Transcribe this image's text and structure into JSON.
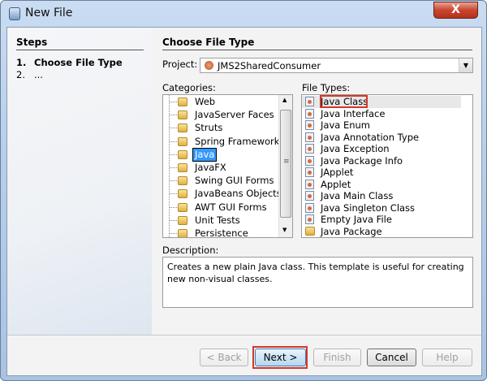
{
  "window": {
    "title": "New File",
    "close": "X"
  },
  "steps": {
    "heading": "Steps",
    "items": [
      {
        "num": "1.",
        "label": "Choose File Type"
      },
      {
        "num": "2.",
        "label": "..."
      }
    ]
  },
  "main": {
    "heading": "Choose File Type",
    "project_label": "Project:",
    "project_value": "JMS2SharedConsumer",
    "categories_label": "Categories:",
    "categories": [
      "Web",
      "JavaServer Faces",
      "Struts",
      "Spring Framework",
      "Java",
      "JavaFX",
      "Swing GUI Forms",
      "JavaBeans Objects",
      "AWT GUI Forms",
      "Unit Tests",
      "Persistence"
    ],
    "selected_category": "Java",
    "file_types_label": "File Types:",
    "file_types": [
      "Java Class",
      "Java Interface",
      "Java Enum",
      "Java Annotation Type",
      "Java Exception",
      "Java Package Info",
      "JApplet",
      "Applet",
      "Java Main Class",
      "Java Singleton Class",
      "Empty Java File",
      "Java Package"
    ],
    "selected_file_type": "Java Class",
    "description_label": "Description:",
    "description": "Creates a new plain Java class. This template is useful for creating new non-visual classes."
  },
  "buttons": {
    "back": "< Back",
    "next": "Next >",
    "finish": "Finish",
    "cancel": "Cancel",
    "help": "Help"
  }
}
